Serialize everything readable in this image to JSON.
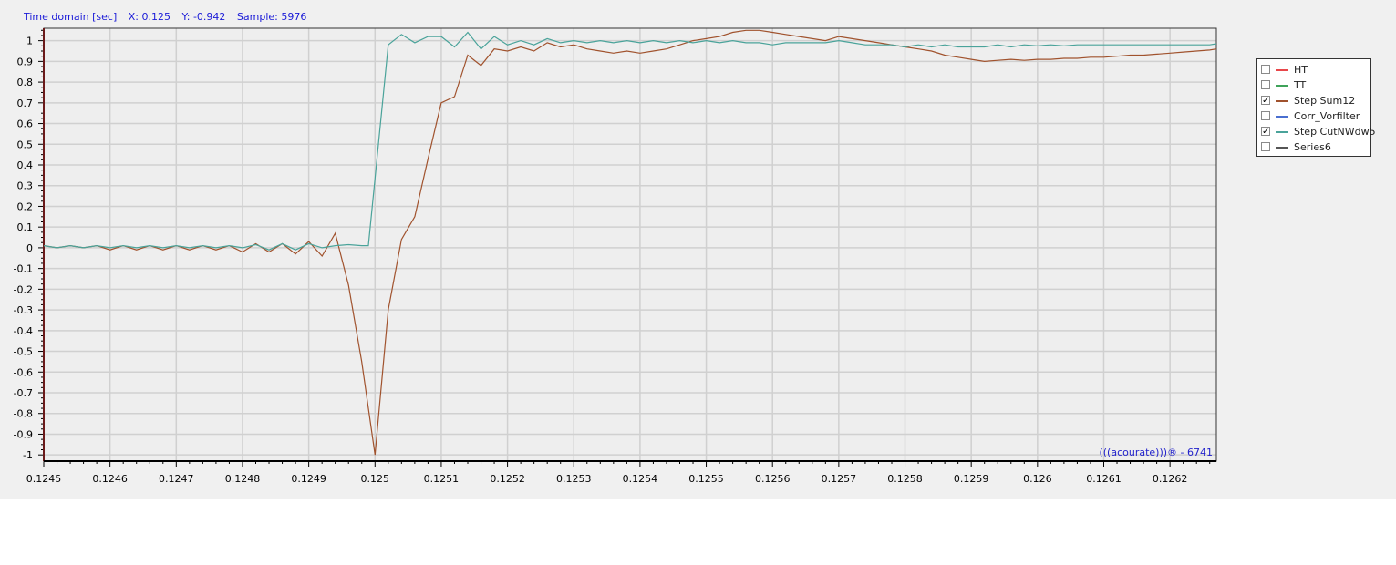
{
  "status": {
    "domain_label": "Time domain [sec]",
    "x_readout": "X: 0.125",
    "y_readout": "Y: -0.942",
    "sample_readout": "Sample: 5976"
  },
  "legend": [
    {
      "label": "HT",
      "color": "#e8474a",
      "checked": false
    },
    {
      "label": "TT",
      "color": "#3fa35a",
      "checked": false
    },
    {
      "label": "Step Sum12",
      "color": "#a0522d",
      "checked": true
    },
    {
      "label": "Corr_Vorfilter",
      "color": "#4a6fd0",
      "checked": false
    },
    {
      "label": "Step CutNWdw5",
      "color": "#4aa39a",
      "checked": true
    },
    {
      "label": "Series6",
      "color": "#555555",
      "checked": false
    }
  ],
  "watermark": "(((acourate)))® - 6741",
  "chart_data": {
    "type": "line",
    "title": "",
    "xlabel": "Time domain [sec]",
    "ylabel": "",
    "xlim": [
      0.1245,
      0.12627
    ],
    "ylim": [
      -1.03,
      1.06
    ],
    "grid": true,
    "legend_position": "right",
    "x_ticks": [
      "0.1245",
      "0.1246",
      "0.1247",
      "0.1248",
      "0.1249",
      "0.125",
      "0.1251",
      "0.1252",
      "0.1253",
      "0.1254",
      "0.1255",
      "0.1256",
      "0.1257",
      "0.1258",
      "0.1259",
      "0.126",
      "0.1261",
      "0.1262"
    ],
    "y_ticks": [
      "1",
      "0.9",
      "0.8",
      "0.7",
      "0.6",
      "0.5",
      "0.4",
      "0.3",
      "0.2",
      "0.1",
      "0",
      "-0.1",
      "-0.2",
      "-0.3",
      "-0.4",
      "-0.5",
      "-0.6",
      "-0.7",
      "-0.8",
      "-0.9",
      "-1"
    ],
    "series": [
      {
        "name": "Step Sum12",
        "color": "#a0522d",
        "points": [
          [
            0.1245,
            0.01
          ],
          [
            0.12452,
            0.0
          ],
          [
            0.12454,
            0.01
          ],
          [
            0.12456,
            0.0
          ],
          [
            0.12458,
            0.01
          ],
          [
            0.1246,
            -0.01
          ],
          [
            0.12462,
            0.01
          ],
          [
            0.12464,
            -0.01
          ],
          [
            0.12466,
            0.01
          ],
          [
            0.12468,
            -0.01
          ],
          [
            0.1247,
            0.01
          ],
          [
            0.12472,
            -0.01
          ],
          [
            0.12474,
            0.01
          ],
          [
            0.12476,
            -0.01
          ],
          [
            0.12478,
            0.01
          ],
          [
            0.1248,
            -0.02
          ],
          [
            0.12482,
            0.02
          ],
          [
            0.12484,
            -0.02
          ],
          [
            0.12486,
            0.02
          ],
          [
            0.12488,
            -0.03
          ],
          [
            0.1249,
            0.03
          ],
          [
            0.12492,
            -0.04
          ],
          [
            0.12494,
            0.07
          ],
          [
            0.12496,
            -0.18
          ],
          [
            0.12498,
            -0.55
          ],
          [
            0.125,
            -1.0
          ],
          [
            0.12502,
            -0.3
          ],
          [
            0.12504,
            0.04
          ],
          [
            0.12506,
            0.15
          ],
          [
            0.12508,
            0.43
          ],
          [
            0.1251,
            0.7
          ],
          [
            0.12512,
            0.73
          ],
          [
            0.12514,
            0.93
          ],
          [
            0.12516,
            0.88
          ],
          [
            0.12518,
            0.96
          ],
          [
            0.1252,
            0.95
          ],
          [
            0.12522,
            0.97
          ],
          [
            0.12524,
            0.95
          ],
          [
            0.12526,
            0.99
          ],
          [
            0.12528,
            0.97
          ],
          [
            0.1253,
            0.98
          ],
          [
            0.12532,
            0.96
          ],
          [
            0.12534,
            0.95
          ],
          [
            0.12536,
            0.94
          ],
          [
            0.12538,
            0.95
          ],
          [
            0.1254,
            0.94
          ],
          [
            0.12542,
            0.95
          ],
          [
            0.12544,
            0.96
          ],
          [
            0.12546,
            0.98
          ],
          [
            0.12548,
            1.0
          ],
          [
            0.1255,
            1.01
          ],
          [
            0.12552,
            1.02
          ],
          [
            0.12554,
            1.04
          ],
          [
            0.12556,
            1.05
          ],
          [
            0.12558,
            1.05
          ],
          [
            0.1256,
            1.04
          ],
          [
            0.12562,
            1.03
          ],
          [
            0.12564,
            1.02
          ],
          [
            0.12566,
            1.01
          ],
          [
            0.12568,
            1.0
          ],
          [
            0.1257,
            1.02
          ],
          [
            0.12572,
            1.01
          ],
          [
            0.12574,
            1.0
          ],
          [
            0.12576,
            0.99
          ],
          [
            0.12578,
            0.98
          ],
          [
            0.1258,
            0.97
          ],
          [
            0.12582,
            0.96
          ],
          [
            0.12584,
            0.95
          ],
          [
            0.12586,
            0.93
          ],
          [
            0.12588,
            0.92
          ],
          [
            0.1259,
            0.91
          ],
          [
            0.12592,
            0.9
          ],
          [
            0.12594,
            0.905
          ],
          [
            0.12596,
            0.91
          ],
          [
            0.12598,
            0.905
          ],
          [
            0.126,
            0.91
          ],
          [
            0.12602,
            0.91
          ],
          [
            0.12604,
            0.915
          ],
          [
            0.12606,
            0.915
          ],
          [
            0.12608,
            0.92
          ],
          [
            0.1261,
            0.92
          ],
          [
            0.12612,
            0.925
          ],
          [
            0.12614,
            0.93
          ],
          [
            0.12616,
            0.93
          ],
          [
            0.12618,
            0.935
          ],
          [
            0.1262,
            0.94
          ],
          [
            0.12622,
            0.945
          ],
          [
            0.12624,
            0.95
          ],
          [
            0.12626,
            0.955
          ],
          [
            0.12627,
            0.96
          ]
        ]
      },
      {
        "name": "Step CutNWdw5",
        "color": "#4aa39a",
        "points": [
          [
            0.1245,
            0.01
          ],
          [
            0.12452,
            0.0
          ],
          [
            0.12454,
            0.01
          ],
          [
            0.12456,
            0.0
          ],
          [
            0.12458,
            0.01
          ],
          [
            0.1246,
            0.0
          ],
          [
            0.12462,
            0.01
          ],
          [
            0.12464,
            0.0
          ],
          [
            0.12466,
            0.01
          ],
          [
            0.12468,
            0.0
          ],
          [
            0.1247,
            0.01
          ],
          [
            0.12472,
            0.0
          ],
          [
            0.12474,
            0.01
          ],
          [
            0.12476,
            0.0
          ],
          [
            0.12478,
            0.01
          ],
          [
            0.1248,
            0.0
          ],
          [
            0.12482,
            0.015
          ],
          [
            0.12484,
            -0.01
          ],
          [
            0.12486,
            0.02
          ],
          [
            0.12488,
            -0.01
          ],
          [
            0.1249,
            0.02
          ],
          [
            0.12492,
            0.0
          ],
          [
            0.12494,
            0.01
          ],
          [
            0.12496,
            0.015
          ],
          [
            0.12498,
            0.01
          ],
          [
            0.12499,
            0.01
          ],
          [
            0.12502,
            0.98
          ],
          [
            0.12504,
            1.03
          ],
          [
            0.12506,
            0.99
          ],
          [
            0.12508,
            1.02
          ],
          [
            0.1251,
            1.02
          ],
          [
            0.12512,
            0.97
          ],
          [
            0.12514,
            1.04
          ],
          [
            0.12516,
            0.96
          ],
          [
            0.12518,
            1.02
          ],
          [
            0.1252,
            0.98
          ],
          [
            0.12522,
            1.0
          ],
          [
            0.12524,
            0.98
          ],
          [
            0.12526,
            1.01
          ],
          [
            0.12528,
            0.99
          ],
          [
            0.1253,
            1.0
          ],
          [
            0.12532,
            0.99
          ],
          [
            0.12534,
            1.0
          ],
          [
            0.12536,
            0.99
          ],
          [
            0.12538,
            1.0
          ],
          [
            0.1254,
            0.99
          ],
          [
            0.12542,
            1.0
          ],
          [
            0.12544,
            0.99
          ],
          [
            0.12546,
            1.0
          ],
          [
            0.12548,
            0.99
          ],
          [
            0.1255,
            1.0
          ],
          [
            0.12552,
            0.99
          ],
          [
            0.12554,
            1.0
          ],
          [
            0.12556,
            0.99
          ],
          [
            0.12558,
            0.99
          ],
          [
            0.1256,
            0.98
          ],
          [
            0.12562,
            0.99
          ],
          [
            0.12564,
            0.99
          ],
          [
            0.12566,
            0.99
          ],
          [
            0.12568,
            0.99
          ],
          [
            0.1257,
            1.0
          ],
          [
            0.12572,
            0.99
          ],
          [
            0.12574,
            0.98
          ],
          [
            0.12576,
            0.98
          ],
          [
            0.12578,
            0.98
          ],
          [
            0.1258,
            0.97
          ],
          [
            0.12582,
            0.98
          ],
          [
            0.12584,
            0.97
          ],
          [
            0.12586,
            0.98
          ],
          [
            0.12588,
            0.97
          ],
          [
            0.1259,
            0.97
          ],
          [
            0.12592,
            0.97
          ],
          [
            0.12594,
            0.98
          ],
          [
            0.12596,
            0.97
          ],
          [
            0.12598,
            0.98
          ],
          [
            0.126,
            0.975
          ],
          [
            0.12602,
            0.98
          ],
          [
            0.12604,
            0.975
          ],
          [
            0.12606,
            0.98
          ],
          [
            0.12608,
            0.98
          ],
          [
            0.1261,
            0.98
          ],
          [
            0.12612,
            0.98
          ],
          [
            0.12614,
            0.98
          ],
          [
            0.12616,
            0.98
          ],
          [
            0.12618,
            0.98
          ],
          [
            0.1262,
            0.98
          ],
          [
            0.12622,
            0.98
          ],
          [
            0.12624,
            0.98
          ],
          [
            0.12626,
            0.98
          ],
          [
            0.12627,
            0.985
          ]
        ]
      }
    ]
  }
}
